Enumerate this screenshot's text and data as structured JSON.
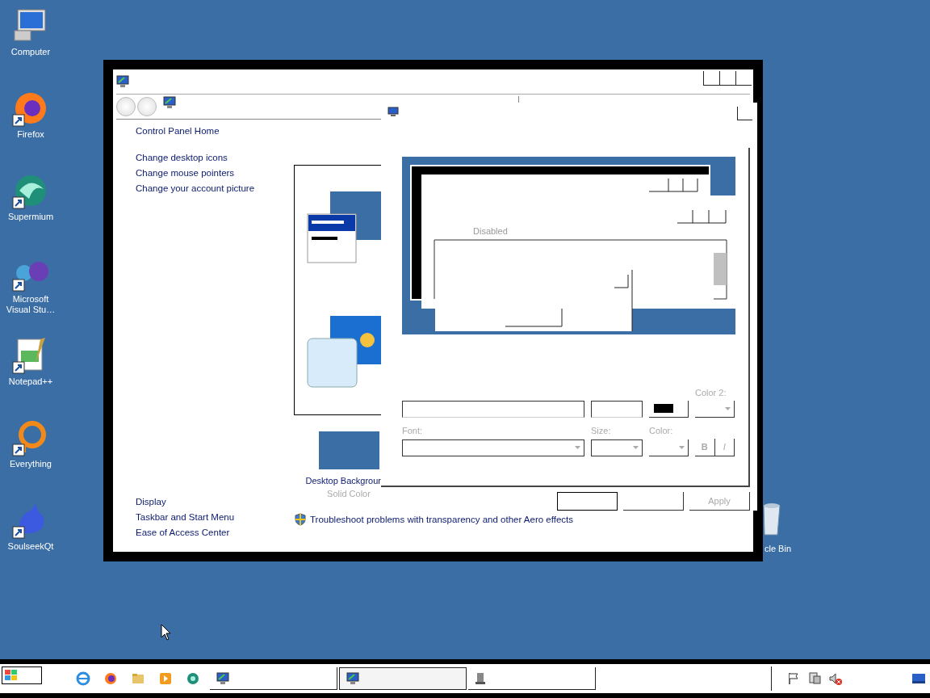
{
  "desktop_icons": [
    {
      "label": "Computer",
      "kind": "computer",
      "shortcut": false
    },
    {
      "label": "Firefox",
      "kind": "firefox",
      "shortcut": true
    },
    {
      "label": "Supermium",
      "kind": "supermium",
      "shortcut": true
    },
    {
      "label": "Microsoft Visual Stu…",
      "kind": "visual-studio",
      "shortcut": true
    },
    {
      "label": "Notepad++",
      "kind": "notepad",
      "shortcut": true
    },
    {
      "label": "Everything",
      "kind": "everything",
      "shortcut": true
    },
    {
      "label": "SoulseekQt",
      "kind": "bird",
      "shortcut": true
    }
  ],
  "recycle_bin": {
    "label": "cle Bin"
  },
  "control_panel": {
    "tasks": [
      {
        "label": "Control Panel Home"
      },
      {
        "label": "Change desktop icons"
      },
      {
        "label": "Change mouse pointers"
      },
      {
        "label": "Change your account picture"
      }
    ],
    "see_also": [
      {
        "label": "Display"
      },
      {
        "label": "Taskbar and Start Menu"
      },
      {
        "label": "Ease of Access Center"
      }
    ],
    "background_tile": {
      "label": "Desktop Backgrour",
      "sublabel": "Solid Color"
    },
    "troubleshoot": "Troubleshoot problems with transparency and other Aero effects"
  },
  "dialog": {
    "preview_label": "Disabled",
    "controls_disabled": true,
    "color2_label": "Color 2:",
    "font_label": "Font:",
    "size_label": "Size:",
    "color_label": "Color:",
    "style_buttons": [
      {
        "label": "B"
      },
      {
        "label": "I"
      }
    ],
    "apply": {
      "label": "Apply",
      "disabled": true
    }
  },
  "taskbar": {
    "quick_launch": [
      {
        "kind": "ie"
      },
      {
        "kind": "firefox"
      },
      {
        "kind": "folder"
      },
      {
        "kind": "media"
      },
      {
        "kind": "supermium"
      }
    ],
    "tasks": [
      {
        "kind": "monitor",
        "selected": false
      },
      {
        "kind": "monitor",
        "selected": true
      },
      {
        "kind": "file",
        "selected": false
      }
    ],
    "tray": [
      {
        "kind": "flag"
      },
      {
        "kind": "network"
      },
      {
        "kind": "muted"
      }
    ]
  }
}
